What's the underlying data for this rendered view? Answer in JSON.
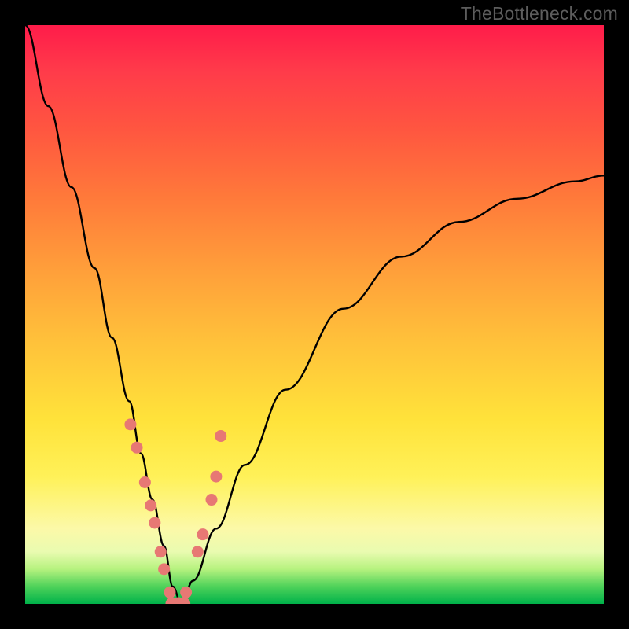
{
  "watermark": "TheBottleneck.com",
  "colors": {
    "frame_bg": "#000000",
    "curve": "#000000",
    "dots": "#e77874"
  },
  "chart_data": {
    "type": "line",
    "title": "",
    "subtitle": "",
    "xlabel": "",
    "ylabel": "",
    "xlim": [
      0,
      100
    ],
    "ylim": [
      0,
      100
    ],
    "grid": false,
    "legend": false,
    "annotations": [
      "TheBottleneck.com"
    ],
    "note": "No axis ticks or labels rendered. Vertical axis appears as bottleneck percentage (0 at bottom, ~100 at top). Horizontal axis is an unlabeled component scale. Values estimated from plotted curve.",
    "series": [
      {
        "name": "bottleneck-curve",
        "x": [
          0,
          4,
          8,
          12,
          15,
          18,
          20,
          22,
          24,
          25.5,
          27,
          29,
          33,
          38,
          45,
          55,
          65,
          75,
          85,
          95,
          100
        ],
        "y": [
          100,
          86,
          72,
          58,
          46,
          35,
          26,
          18,
          10,
          3,
          0,
          4,
          13,
          24,
          37,
          51,
          60,
          66,
          70,
          73,
          74
        ]
      }
    ],
    "points": {
      "name": "highlighted-dots",
      "note": "Pink dots clustered near curve around the minimum, roughly in y-range 0–30.",
      "left_branch": {
        "x": [
          18.2,
          19.3,
          20.7,
          21.7,
          22.4,
          23.4,
          24.0,
          25.0,
          25.8
        ],
        "y": [
          31,
          27,
          21,
          17,
          14,
          9,
          6,
          2,
          0
        ]
      },
      "right_branch": {
        "x": [
          26.8,
          27.8,
          29.8,
          30.7,
          32.2,
          33.0,
          33.8
        ],
        "y": [
          0,
          2,
          9,
          12,
          18,
          22,
          29
        ]
      },
      "trough": {
        "x": [
          25.4,
          26.5,
          27.4
        ],
        "y": [
          0,
          0,
          0
        ]
      }
    }
  }
}
